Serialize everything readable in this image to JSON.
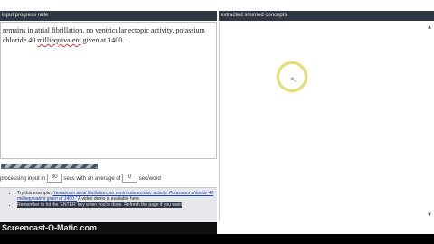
{
  "left_pane": {
    "header": "input progress note",
    "note_text_before": "remains in atrial fibrillation. no ventricular ectopic activity. potassium chloride 40 ",
    "note_text_misspelled": "milliequivalent",
    "note_text_after": " given at 1400."
  },
  "right_pane": {
    "header": "extracted snomed concepts",
    "scroll_up_icon": "triangle-up",
    "scroll_down_icon": "triangle-down"
  },
  "progress": {
    "fraction": 1.0
  },
  "controls": {
    "label_prefix": "processing input in",
    "seconds_value": "30",
    "label_middle": "secs with an average of",
    "average_value": "0",
    "label_suffix": "sec/word"
  },
  "tips": {
    "try_prefix": "Try this example, ",
    "try_example": "\"remains in atrial fibrillation. no ventricular ectopic activity. Potassium chloride 40 milliequivalent given at 1400.\"",
    "try_suffix": " A video demo is available here.",
    "reminder": "Remember to hit the 'ENTER' key when you're done. Refresh the page if you want"
  },
  "watermark": "Screencast-O-Matic.com",
  "colors": {
    "header_bg": "#2f3644",
    "ring": "#e6dc78"
  }
}
